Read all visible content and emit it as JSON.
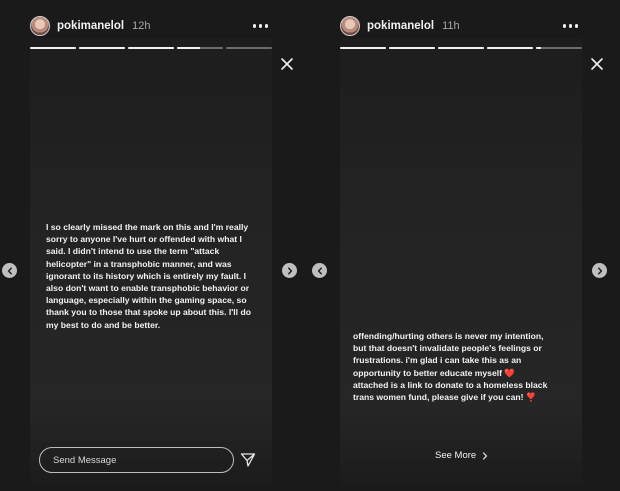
{
  "left_story": {
    "username": "pokimanelol",
    "timestamp": "12h",
    "progress": [
      1,
      1,
      1,
      0.5,
      0
    ],
    "body": "I so clearly missed the mark on this and I'm really\nsorry to anyone I've hurt or offended with what I\nsaid. I didn't intend to use the term \"attack\nhelicopter\" in a transphobic manner, and was\nignorant to its history which is entirely my fault. I\nalso don't want to enable transphobic behavior or\nlanguage, especially within the gaming space, so\nthank you to those that spoke up about this. I'll do\nmy best to do and be better.",
    "send_message_placeholder": "Send Message"
  },
  "right_story": {
    "username": "pokimanelol",
    "timestamp": "11h",
    "progress": [
      1,
      1,
      1,
      1,
      0.1
    ],
    "body": "offending/hurting others is never my intention,\nbut that doesn't invalidate people's feelings or\nfrustrations. i'm glad i can take this as an\nopportunity to better educate myself ❤️\nattached is a link to donate to a homeless black\ntrans women fund, please give if you can! ❣️",
    "see_more_label": "See More"
  },
  "icons": {
    "more": "more-options-icon",
    "close": "close-icon",
    "nav_prev": "chevron-left-icon",
    "nav_next": "chevron-right-icon",
    "send": "paper-plane-icon",
    "see_more": "chevron-right-icon"
  }
}
